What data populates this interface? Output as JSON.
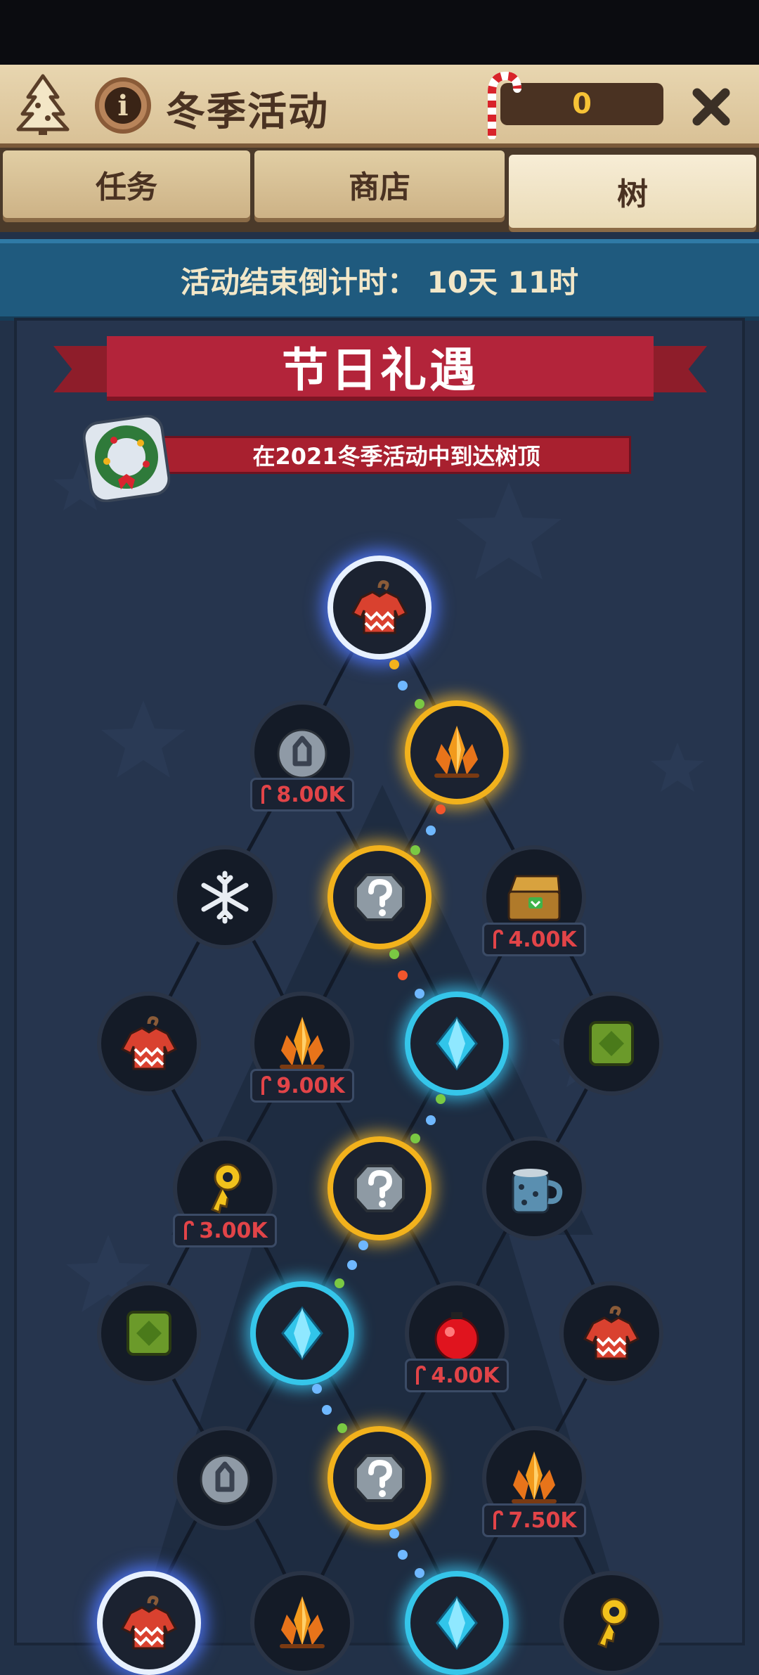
{
  "header": {
    "title": "冬季活动",
    "candy_count": "0"
  },
  "tabs": [
    {
      "label": "任务",
      "active": false
    },
    {
      "label": "商店",
      "active": false
    },
    {
      "label": "树",
      "active": true
    }
  ],
  "countdown": {
    "text": "活动结束倒计时： 10天 11时"
  },
  "banner": {
    "title": "节日礼遇"
  },
  "goal": {
    "text": "在2021冬季活动中到达树顶"
  },
  "nodes": [
    {
      "id": "top-sweater",
      "icon": "sweater-icon",
      "state": "goal"
    },
    {
      "id": "stone-8k",
      "icon": "stone-weight-icon",
      "state": "locked",
      "price": "8.00K"
    },
    {
      "id": "crystal-gold-1",
      "icon": "orange-crystal-icon",
      "state": "path"
    },
    {
      "id": "snowflake",
      "icon": "snowflake-icon",
      "state": "locked"
    },
    {
      "id": "mystery-1",
      "icon": "mystery-icon",
      "state": "path"
    },
    {
      "id": "chest-4k",
      "icon": "treasure-chest-icon",
      "state": "locked",
      "price": "4.00K"
    },
    {
      "id": "sweater-left",
      "icon": "sweater-icon",
      "state": "locked"
    },
    {
      "id": "crystal-9k",
      "icon": "orange-crystal-icon",
      "state": "locked",
      "price": "9.00K"
    },
    {
      "id": "gem-1",
      "icon": "blue-gem-icon",
      "state": "gem"
    },
    {
      "id": "green-block-1",
      "icon": "green-block-icon",
      "state": "locked"
    },
    {
      "id": "key-3k",
      "icon": "key-icon",
      "state": "locked",
      "price": "3.00K"
    },
    {
      "id": "mystery-2",
      "icon": "mystery-icon",
      "state": "path"
    },
    {
      "id": "mug",
      "icon": "mug-icon",
      "state": "locked"
    },
    {
      "id": "green-block-2",
      "icon": "green-block-icon",
      "state": "locked"
    },
    {
      "id": "gem-2",
      "icon": "blue-gem-icon",
      "state": "gem"
    },
    {
      "id": "ornament-4k",
      "icon": "ornament-icon",
      "state": "locked",
      "price": "4.00K"
    },
    {
      "id": "sweater-right",
      "icon": "sweater-icon",
      "state": "locked"
    },
    {
      "id": "stone-2",
      "icon": "stone-weight-icon",
      "state": "locked"
    },
    {
      "id": "mystery-3",
      "icon": "mystery-icon",
      "state": "path"
    },
    {
      "id": "crystal-7k",
      "icon": "orange-crystal-icon",
      "state": "locked",
      "price": "7.50K"
    },
    {
      "id": "sweater-bottom",
      "icon": "sweater-icon",
      "state": "goal"
    },
    {
      "id": "crystal-bottom",
      "icon": "orange-crystal-icon",
      "state": "locked"
    },
    {
      "id": "gem-3",
      "icon": "blue-gem-icon",
      "state": "gem"
    },
    {
      "id": "key-bottom",
      "icon": "key-icon",
      "state": "locked"
    }
  ],
  "colors": {
    "path_gold": "#f2b21c",
    "gem_cyan": "#35c6ea",
    "price_red": "#e24448",
    "banner_red": "#b3243a"
  }
}
